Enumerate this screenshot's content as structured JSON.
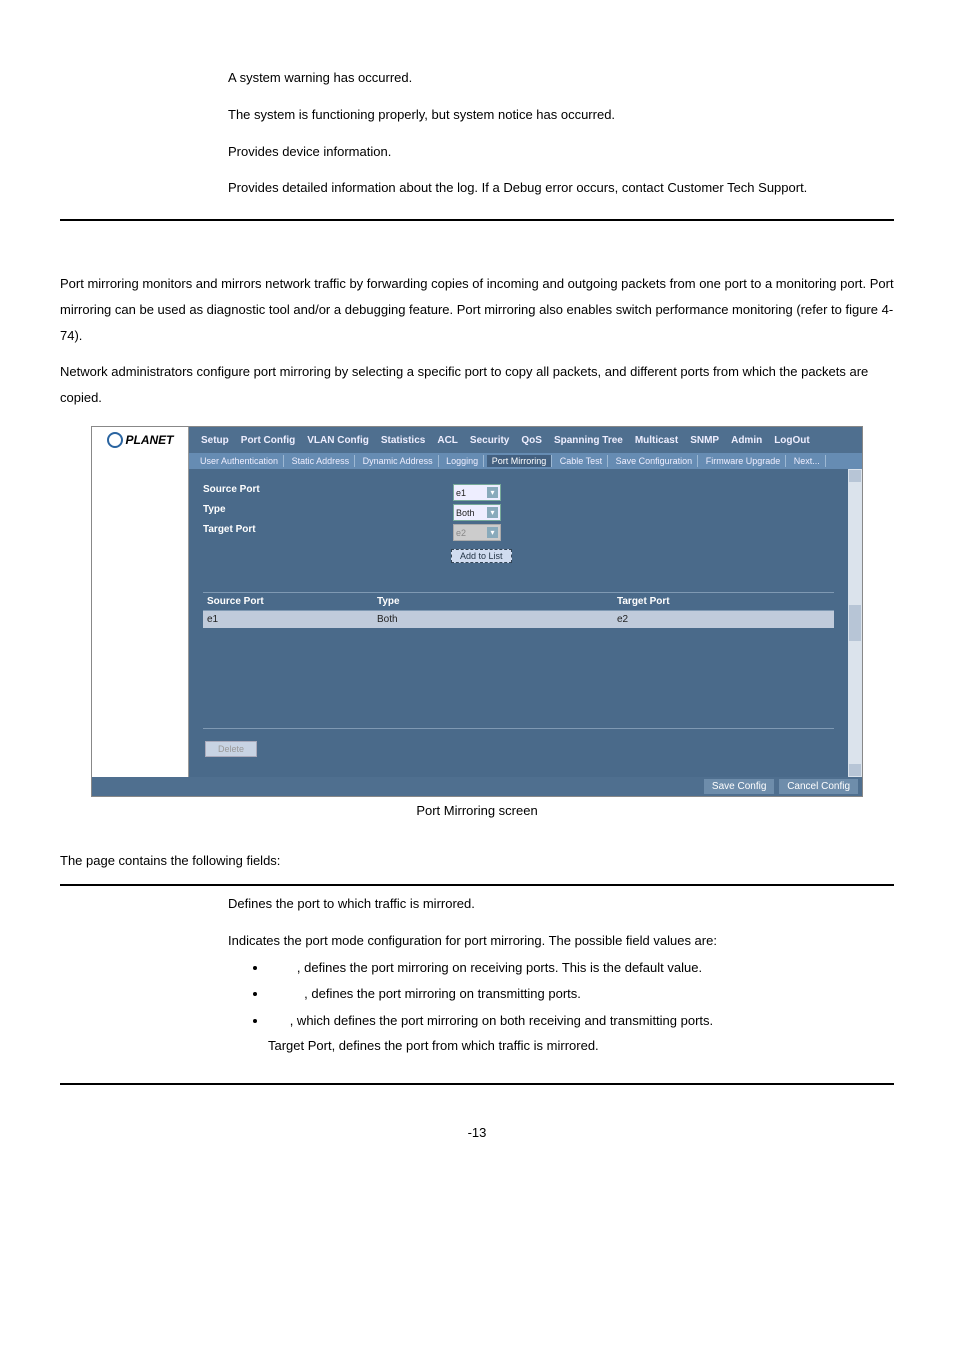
{
  "top_table": {
    "rows": [
      {
        "desc": "A system warning has occurred."
      },
      {
        "desc": "The system is functioning properly, but system notice has occurred."
      },
      {
        "desc": "Provides device information."
      },
      {
        "desc": "Provides detailed information about the log. If a Debug error occurs, contact Customer Tech Support."
      }
    ]
  },
  "intro": {
    "p1": "Port mirroring monitors and mirrors network traffic by forwarding copies of incoming and outgoing packets from one port to a monitoring port. Port mirroring can be used as diagnostic tool and/or a debugging feature. Port mirroring also enables switch performance monitoring (refer to figure 4-74).",
    "p2": "Network administrators configure port mirroring by selecting a specific port to copy all packets, and different ports from which the packets are copied."
  },
  "screenshot": {
    "logo": "PLANET",
    "menu": [
      "Setup",
      "Port Config",
      "VLAN Config",
      "Statistics",
      "ACL",
      "Security",
      "QoS",
      "Spanning Tree",
      "Multicast",
      "SNMP",
      "Admin",
      "LogOut"
    ],
    "tabs": [
      "User Authentication",
      "Static Address",
      "Dynamic Address",
      "Logging",
      "Port Mirroring",
      "Cable Test",
      "Save Configuration",
      "Firmware Upgrade",
      "Next..."
    ],
    "active_tab_index": 4,
    "form": {
      "source_port_label": "Source Port",
      "type_label": "Type",
      "target_port_label": "Target Port",
      "source_port_value": "e1",
      "type_value": "Both",
      "target_port_value": "e2",
      "add_btn": "Add to List"
    },
    "list": {
      "headers": [
        "Source Port",
        "Type",
        "Target Port"
      ],
      "row": {
        "c1": "e1",
        "c2": "Both",
        "c3": "e2"
      },
      "delete_btn": "Delete"
    },
    "footer": {
      "save": "Save Config",
      "cancel": "Cancel Config"
    }
  },
  "fig_caption": "Port Mirroring screen",
  "fields_intro": "The page contains the following fields:",
  "bottom_table": {
    "r1_desc": "Defines the port to which traffic is mirrored.",
    "r2_desc": "Indicates the port mode configuration for port mirroring. The possible field values are:",
    "r2_b1": ", defines the port mirroring on receiving ports. This is the default value.",
    "r2_b2": ", defines the port mirroring on transmitting ports.",
    "r2_b3_a": ", which defines the port mirroring on both receiving and transmitting ports.",
    "r2_b3_b": "Target Port, defines the port from which traffic is mirrored."
  },
  "page_number": "-13"
}
